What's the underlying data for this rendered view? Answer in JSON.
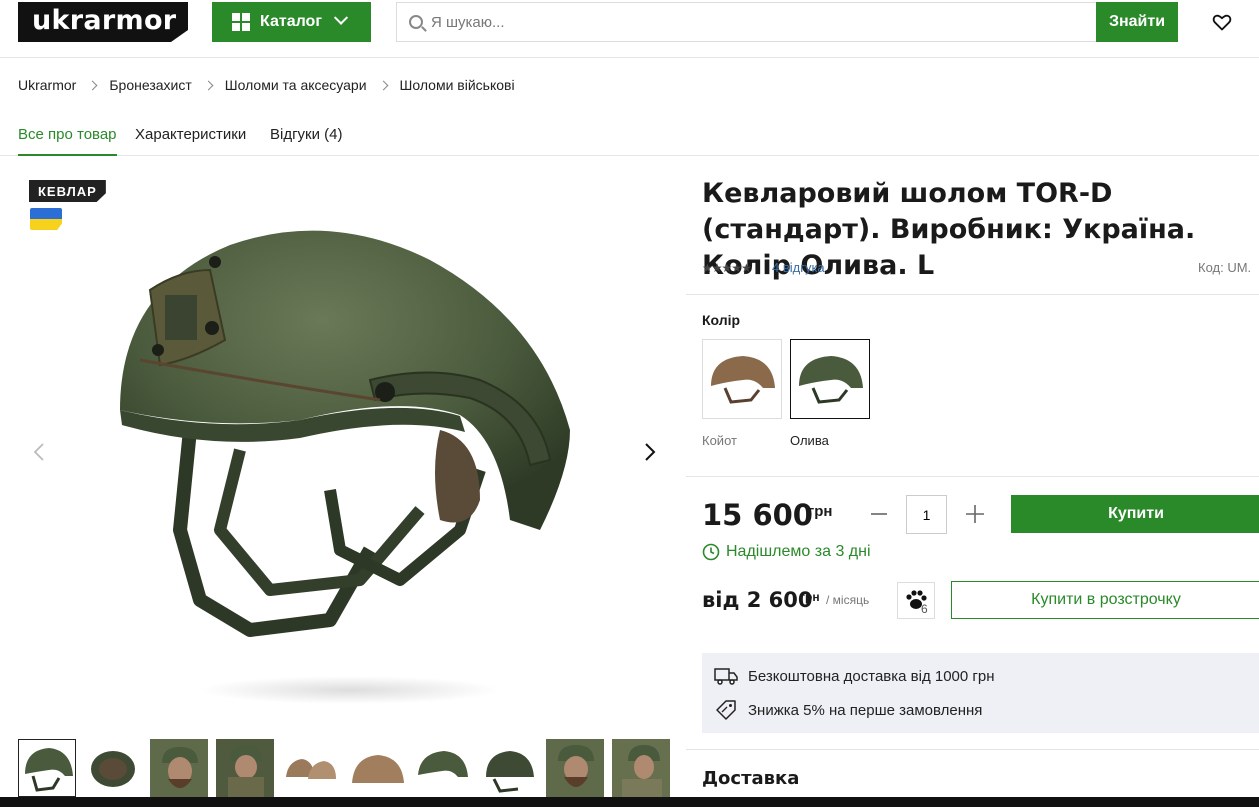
{
  "header": {
    "logo": "ukrarmor",
    "catalog_label": "Каталог",
    "search_placeholder": "Я шукаю...",
    "search_button": "Знайти"
  },
  "breadcrumb": [
    "Ukrarmor",
    "Бронезахист",
    "Шоломи та аксесуари",
    "Шоломи військові"
  ],
  "tabs": [
    {
      "label": "Все про товар",
      "active": true
    },
    {
      "label": "Характеристики",
      "active": false
    },
    {
      "label": "Відгуки (4)",
      "active": false
    }
  ],
  "gallery": {
    "badge": "КЕВЛАР",
    "thumbnail_count": 10
  },
  "product": {
    "title": "Кевларовий шолом TOR-D (стандарт). Виробник: Україна. Колір Олива. L",
    "rating_stars": "★★★★★",
    "rating": 5,
    "reviews_link": "4 відгука",
    "code": "Код: UM.",
    "color_label": "Колір",
    "colors": [
      {
        "name": "Койот",
        "selected": false,
        "hex": "#8a6a4a"
      },
      {
        "name": "Олива",
        "selected": true,
        "hex": "#4a5a3c"
      }
    ],
    "price": "15 600",
    "currency": "грн",
    "quantity": "1",
    "buy_button": "Купити",
    "shipping_note": "Надішлемо за 3 дні",
    "installment_price": "від 2 600",
    "installment_currency": "грн",
    "installment_period": "/ місяць",
    "installment_count": "6",
    "installment_button": "Купити в розстрочку",
    "promos": [
      "Безкоштовна доставка від 1000 грн",
      "Знижка 5% на перше замовлення"
    ],
    "delivery_heading": "Доставка"
  },
  "colors": {
    "accent": "#2a8a2a",
    "link": "#3a6ea5",
    "helmet_olive": "#4a5a3c"
  }
}
